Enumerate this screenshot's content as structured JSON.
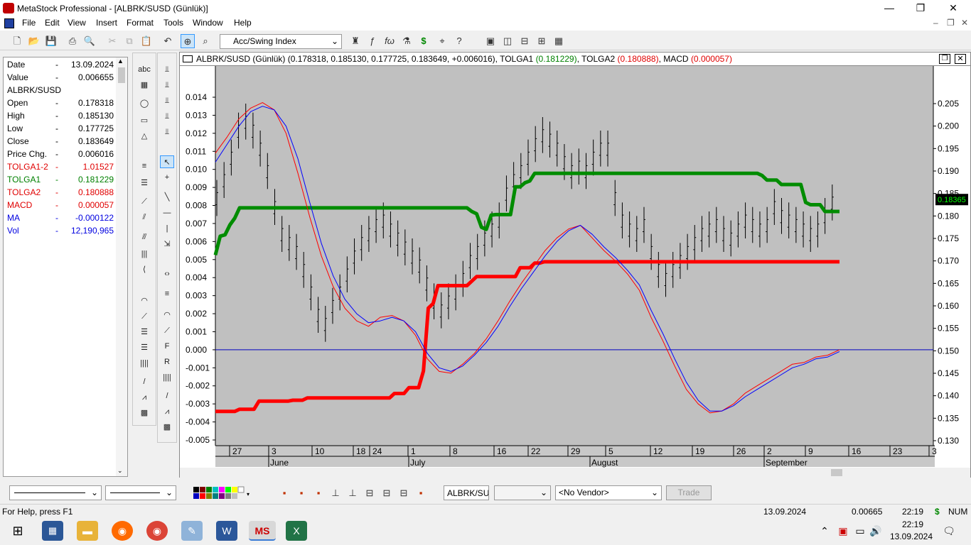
{
  "window": {
    "title": "MetaStock Professional - [ALBRK/SUSD (Günlük)]",
    "minimize": "—",
    "restore": "❐",
    "close": "✕"
  },
  "menu": [
    "File",
    "Edit",
    "View",
    "Insert",
    "Format",
    "Tools",
    "Window",
    "Help"
  ],
  "toolbar": {
    "indicator_select": "Acc/Swing Index"
  },
  "data_window": {
    "rows": [
      {
        "label": "Date",
        "value": "13.09.2024",
        "color": "#000000"
      },
      {
        "label": "Value",
        "value": "0.006655",
        "color": "#000000"
      },
      {
        "label": "ALBRK/SUSD",
        "value": "",
        "color": "#000000"
      },
      {
        "label": "Open",
        "value": "0.178318",
        "color": "#000000"
      },
      {
        "label": "High",
        "value": "0.185130",
        "color": "#000000"
      },
      {
        "label": "Low",
        "value": "0.177725",
        "color": "#000000"
      },
      {
        "label": "Close",
        "value": "0.183649",
        "color": "#000000"
      },
      {
        "label": "Price Chg.",
        "value": "0.006016",
        "color": "#000000"
      },
      {
        "label": "TOLGA1-2",
        "value": "1.01527",
        "color": "#e00000"
      },
      {
        "label": "TOLGA1",
        "value": "0.181229",
        "color": "#008000"
      },
      {
        "label": "TOLGA2",
        "value": "0.180888",
        "color": "#e00000"
      },
      {
        "label": "MACD",
        "value": "0.000057",
        "color": "#e00000"
      },
      {
        "label": "MA",
        "value": "-0.000122",
        "color": "#0000e0"
      },
      {
        "label": "Vol",
        "value": "12,190,965",
        "color": "#0000e0"
      }
    ]
  },
  "chart_header": {
    "prefix": "ALBRK/SUSD (Günlük) (0.178318, 0.185130, 0.177725, 0.183649, +0.006016), TOLGA1",
    "tolga1": "(0.181229)",
    "sep1": ", TOLGA2",
    "tolga2": "(0.180888)",
    "sep2": ", MACD",
    "macd": "(0.000057)"
  },
  "chart_data": {
    "type": "line",
    "left_axis": {
      "ticks": [
        "0.014",
        "0.013",
        "0.012",
        "0.011",
        "0.010",
        "0.009",
        "0.008",
        "0.007",
        "0.006",
        "0.005",
        "0.004",
        "0.003",
        "0.002",
        "0.001",
        "0.000",
        "-0.001",
        "-0.002",
        "-0.003",
        "-0.004",
        "-0.005"
      ],
      "range": [
        -0.005,
        0.014
      ]
    },
    "right_axis": {
      "ticks": [
        "0.205",
        "0.200",
        "0.195",
        "0.190",
        "0.185",
        "0.180",
        "0.175",
        "0.170",
        "0.165",
        "0.160",
        "0.155",
        "0.150",
        "0.145",
        "0.140",
        "0.135",
        "0.130"
      ],
      "range": [
        0.13,
        0.205
      ]
    },
    "last_price_tag": "0.18365",
    "x_day_labels": [
      "27",
      "3",
      "10",
      "18",
      "24",
      "1",
      "8",
      "16",
      "22",
      "29",
      "5",
      "12",
      "19",
      "26",
      "2",
      "9",
      "16",
      "23",
      "3"
    ],
    "x_month_labels": [
      "June",
      "July",
      "August",
      "September"
    ],
    "colors": {
      "tolga1": "#008c00",
      "tolga2": "#ff0000",
      "macd": "#ff0000",
      "ma": "#0000ff",
      "price": "#000000",
      "background": "#c0c0c0",
      "zero_line": "#0000c0"
    },
    "series": [
      {
        "name": "TOLGA1",
        "axis": "right",
        "values": [
          0.1713,
          0.1755,
          0.1758,
          0.178,
          0.1795,
          0.1818,
          0.1818,
          0.1818,
          0.1818,
          0.1818,
          0.1818,
          0.1818,
          0.1818,
          0.1818,
          0.1818,
          0.1818,
          0.1818,
          0.1818,
          0.1818,
          0.1818,
          0.1818,
          0.1818,
          0.1818,
          0.1818,
          0.1818,
          0.1818,
          0.1818,
          0.1818,
          0.1818,
          0.1818,
          0.1818,
          0.1818,
          0.1818,
          0.1818,
          0.1818,
          0.1818,
          0.1818,
          0.1818,
          0.1818,
          0.1818,
          0.1818,
          0.1818,
          0.1818,
          0.1818,
          0.1818,
          0.1818,
          0.1818,
          0.1818,
          0.1818,
          0.1818,
          0.1818,
          0.1818,
          0.1818,
          0.181,
          0.1805,
          0.1775,
          0.177,
          0.1802,
          0.1803,
          0.1803,
          0.1803,
          0.1803,
          0.1865,
          0.1865,
          0.1874,
          0.1878,
          0.1895,
          0.1895,
          0.1895,
          0.1895,
          0.1895,
          0.1895,
          0.1895,
          0.1895,
          0.1895,
          0.1895,
          0.1895,
          0.1895,
          0.1895,
          0.1895,
          0.1895,
          0.1895,
          0.1895,
          0.1895,
          0.1895,
          0.1895,
          0.1895,
          0.1895,
          0.1895,
          0.1895,
          0.1895,
          0.1895,
          0.1895,
          0.1895,
          0.1895,
          0.1895,
          0.1895,
          0.1895,
          0.1895,
          0.1895,
          0.1895,
          0.1895,
          0.1895,
          0.1895,
          0.1895,
          0.1895,
          0.1895,
          0.1895,
          0.1895,
          0.1895,
          0.1895,
          0.1895,
          0.1895,
          0.189,
          0.188,
          0.188,
          0.188,
          0.187,
          0.187,
          0.187,
          0.187,
          0.187,
          0.183,
          0.1825,
          0.1825,
          0.1825,
          0.181,
          0.181,
          0.181,
          0.181
        ]
      },
      {
        "name": "TOLGA2",
        "axis": "right",
        "values": [
          0.1365,
          0.1365,
          0.1365,
          0.1365,
          0.1365,
          0.137,
          0.137,
          0.137,
          0.137,
          0.1388,
          0.1388,
          0.1388,
          0.1388,
          0.1388,
          0.1388,
          0.1388,
          0.139,
          0.139,
          0.139,
          0.1395,
          0.1395,
          0.1395,
          0.1395,
          0.1395,
          0.1395,
          0.1395,
          0.1395,
          0.1395,
          0.1395,
          0.1395,
          0.1395,
          0.1395,
          0.1395,
          0.1395,
          0.1395,
          0.1395,
          0.1395,
          0.1405,
          0.1405,
          0.1405,
          0.1418,
          0.1418,
          0.1418,
          0.1455,
          0.1595,
          0.1605,
          0.1645,
          0.1645,
          0.1645,
          0.1645,
          0.1645,
          0.1645,
          0.1645,
          0.1655,
          0.1665,
          0.1665,
          0.1665,
          0.1665,
          0.1665,
          0.1665,
          0.1665,
          0.1665,
          0.1665,
          0.1685,
          0.1685,
          0.1685,
          0.1695,
          0.1695,
          0.1698,
          0.1698,
          0.1698,
          0.1698,
          0.1698,
          0.1698,
          0.1698,
          0.1698,
          0.1698,
          0.1698,
          0.1698,
          0.1698,
          0.1698,
          0.1698,
          0.1698,
          0.1698,
          0.1698,
          0.1698,
          0.1698,
          0.1698,
          0.1698,
          0.1698,
          0.1698,
          0.1698,
          0.1698,
          0.1698,
          0.1698,
          0.1698,
          0.1698,
          0.1698,
          0.1698,
          0.1698,
          0.1698,
          0.1698,
          0.1698,
          0.1698,
          0.1698,
          0.1698,
          0.1698,
          0.1698,
          0.1698,
          0.1698,
          0.1698,
          0.1698,
          0.1698,
          0.1698,
          0.1698,
          0.1698,
          0.1698,
          0.1698,
          0.1698,
          0.1698,
          0.1698,
          0.1698,
          0.1698,
          0.1698,
          0.1698,
          0.1698,
          0.1698,
          0.1698,
          0.1698,
          0.1698
        ]
      },
      {
        "name": "MACD",
        "axis": "left",
        "values": [
          0.0109,
          0.0118,
          0.0128,
          0.0134,
          0.0137,
          0.0133,
          0.012,
          0.0098,
          0.0074,
          0.0052,
          0.0035,
          0.0023,
          0.0016,
          0.0013,
          0.0018,
          0.0019,
          0.0016,
          0.0008,
          -0.0005,
          -0.0012,
          -0.0013,
          -0.0008,
          -0.0002,
          0.0006,
          0.0016,
          0.0027,
          0.0037,
          0.0046,
          0.0055,
          0.0062,
          0.0067,
          0.0069,
          0.0062,
          0.0055,
          0.0049,
          0.0042,
          0.0033,
          0.0018,
          0.0005,
          -0.0009,
          -0.0022,
          -0.003,
          -0.0035,
          -0.0034,
          -0.003,
          -0.0024,
          -0.002,
          -0.0016,
          -0.0012,
          -0.0008,
          -0.0007,
          -0.0004,
          -0.0003,
          0.0
        ]
      },
      {
        "name": "MA",
        "axis": "left",
        "values": [
          0.0104,
          0.0114,
          0.0124,
          0.0132,
          0.0135,
          0.0133,
          0.0124,
          0.0106,
          0.0082,
          0.0059,
          0.0041,
          0.0028,
          0.002,
          0.0015,
          0.0016,
          0.0018,
          0.0016,
          0.001,
          -0.0002,
          -0.001,
          -0.0012,
          -0.0009,
          -0.0003,
          0.0004,
          0.0013,
          0.0024,
          0.0034,
          0.0043,
          0.0052,
          0.006,
          0.0066,
          0.0069,
          0.0064,
          0.0057,
          0.0051,
          0.0044,
          0.0036,
          0.0022,
          0.0009,
          -0.0005,
          -0.0018,
          -0.0028,
          -0.0034,
          -0.0034,
          -0.0031,
          -0.0026,
          -0.0022,
          -0.0018,
          -0.0014,
          -0.001,
          -0.0008,
          -0.0005,
          -0.0004,
          -0.0001
        ]
      }
    ]
  },
  "bottom_toolbar": {
    "symbol_field": "ALBRK/SUS",
    "vendor": "<No Vendor>",
    "trade": "Trade"
  },
  "status": {
    "help": "For Help, press F1",
    "date": "13.09.2024",
    "value": "0.00665",
    "time": "22:19",
    "dollar": "$",
    "num": "NUM"
  },
  "taskbar": {
    "time": "22:19",
    "date": "13.09.2024"
  }
}
